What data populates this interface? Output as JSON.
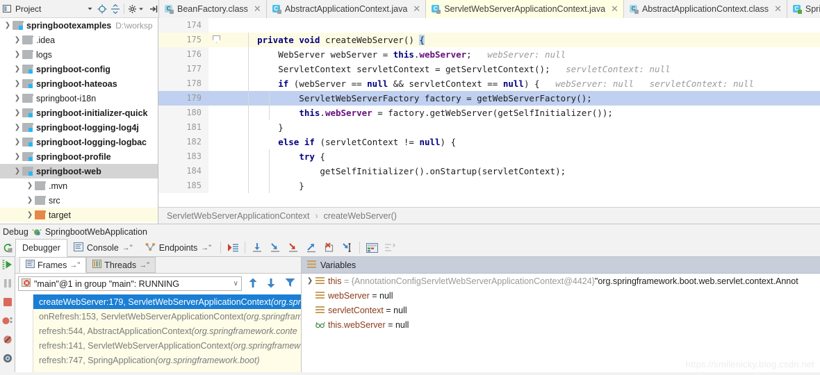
{
  "project_toolbar": {
    "label": "Project",
    "icons": [
      "project-panel-icon",
      "caret-down-icon",
      "locate-icon",
      "expand-collapse-icon",
      "gear-icon",
      "hide-icon"
    ]
  },
  "editor_tabs": [
    {
      "label": "BeanFactory.class",
      "icon": "class-file-icon",
      "active": false,
      "closable": true
    },
    {
      "label": "AbstractApplicationContext.java",
      "icon": "java-file-icon",
      "active": false,
      "closable": true
    },
    {
      "label": "ServletWebServerApplicationContext.java",
      "icon": "java-file-icon",
      "active": true,
      "closable": true
    },
    {
      "label": "AbstractApplicationContext.class",
      "icon": "class-file-icon",
      "active": false,
      "closable": true
    },
    {
      "label": "SpringA",
      "icon": "runnable-java-file-icon",
      "active": false,
      "closable": false
    }
  ],
  "project_tree": [
    {
      "label": "springbootexamples",
      "path": "D:\\worksp",
      "indent": 0,
      "bold": true,
      "expanded": true,
      "folder": "module",
      "selected": false
    },
    {
      "label": ".idea",
      "path": "",
      "indent": 1,
      "bold": false,
      "expanded": false,
      "folder": "plain",
      "selected": false
    },
    {
      "label": "logs",
      "path": "",
      "indent": 1,
      "bold": false,
      "expanded": false,
      "folder": "plain",
      "selected": false
    },
    {
      "label": "springboot-config",
      "path": "",
      "indent": 1,
      "bold": true,
      "expanded": false,
      "folder": "module",
      "selected": false
    },
    {
      "label": "springboot-hateoas",
      "path": "",
      "indent": 1,
      "bold": true,
      "expanded": false,
      "folder": "module",
      "selected": false
    },
    {
      "label": "springboot-i18n",
      "path": "",
      "indent": 1,
      "bold": false,
      "expanded": false,
      "folder": "plain",
      "selected": false
    },
    {
      "label": "springboot-initializer-quick",
      "path": "",
      "indent": 1,
      "bold": true,
      "expanded": false,
      "folder": "module",
      "selected": false
    },
    {
      "label": "springboot-logging-log4j",
      "path": "",
      "indent": 1,
      "bold": true,
      "expanded": false,
      "folder": "module",
      "selected": false
    },
    {
      "label": "springboot-logging-logbac",
      "path": "",
      "indent": 1,
      "bold": true,
      "expanded": false,
      "folder": "module",
      "selected": false
    },
    {
      "label": "springboot-profile",
      "path": "",
      "indent": 1,
      "bold": true,
      "expanded": false,
      "folder": "module",
      "selected": false
    },
    {
      "label": "springboot-web",
      "path": "",
      "indent": 1,
      "bold": true,
      "expanded": true,
      "folder": "module",
      "selected": true
    },
    {
      "label": ".mvn",
      "path": "",
      "indent": 2,
      "bold": false,
      "expanded": false,
      "folder": "plain",
      "selected": false
    },
    {
      "label": "src",
      "path": "",
      "indent": 2,
      "bold": false,
      "expanded": false,
      "folder": "plain",
      "selected": false
    },
    {
      "label": "target",
      "path": "",
      "indent": 2,
      "bold": false,
      "expanded": false,
      "folder": "orange",
      "selected": false,
      "highlighted": true
    }
  ],
  "code_lines": [
    {
      "num": "174",
      "highlight": "none",
      "fold": false,
      "tokens": []
    },
    {
      "num": "175",
      "highlight": "current",
      "fold": true,
      "tokens": [
        {
          "t": "    ",
          "c": "pln"
        },
        {
          "t": "private void ",
          "c": "kw"
        },
        {
          "t": "createWebServer() ",
          "c": "pln"
        },
        {
          "t": "{",
          "c": "caret"
        }
      ]
    },
    {
      "num": "176",
      "highlight": "none",
      "fold": false,
      "tokens": [
        {
          "t": "        WebServer webServer = ",
          "c": "pln"
        },
        {
          "t": "this",
          "c": "kw"
        },
        {
          "t": ".",
          "c": "pln"
        },
        {
          "t": "webServer",
          "c": "fld"
        },
        {
          "t": ";",
          "c": "pln"
        },
        {
          "t": "   webServer: null",
          "c": "hint"
        }
      ]
    },
    {
      "num": "177",
      "highlight": "none",
      "fold": false,
      "tokens": [
        {
          "t": "        ServletContext servletContext = getServletContext();",
          "c": "pln"
        },
        {
          "t": "   servletContext: null",
          "c": "hint"
        }
      ]
    },
    {
      "num": "178",
      "highlight": "none",
      "fold": false,
      "tokens": [
        {
          "t": "        ",
          "c": "pln"
        },
        {
          "t": "if ",
          "c": "kw"
        },
        {
          "t": "(webServer == ",
          "c": "pln"
        },
        {
          "t": "null",
          "c": "kw"
        },
        {
          "t": " && servletContext == ",
          "c": "pln"
        },
        {
          "t": "null",
          "c": "kw"
        },
        {
          "t": ") {",
          "c": "pln"
        },
        {
          "t": "   webServer: null   servletContext: null",
          "c": "hint"
        }
      ]
    },
    {
      "num": "179",
      "highlight": "exec",
      "fold": false,
      "tokens": [
        {
          "t": "            ServletWebServerFactory factory = getWebServerFactory();",
          "c": "pln"
        }
      ]
    },
    {
      "num": "180",
      "highlight": "none",
      "fold": false,
      "tokens": [
        {
          "t": "            ",
          "c": "pln"
        },
        {
          "t": "this",
          "c": "kw"
        },
        {
          "t": ".",
          "c": "pln"
        },
        {
          "t": "webServer",
          "c": "fld"
        },
        {
          "t": " = factory.getWebServer(getSelfInitializer());",
          "c": "pln"
        }
      ]
    },
    {
      "num": "181",
      "highlight": "none",
      "fold": false,
      "tokens": [
        {
          "t": "        }",
          "c": "pln"
        }
      ]
    },
    {
      "num": "182",
      "highlight": "none",
      "fold": false,
      "tokens": [
        {
          "t": "        ",
          "c": "pln"
        },
        {
          "t": "else if ",
          "c": "kw"
        },
        {
          "t": "(servletContext != ",
          "c": "pln"
        },
        {
          "t": "null",
          "c": "kw"
        },
        {
          "t": ") {",
          "c": "pln"
        }
      ]
    },
    {
      "num": "183",
      "highlight": "none",
      "fold": false,
      "tokens": [
        {
          "t": "            ",
          "c": "pln"
        },
        {
          "t": "try ",
          "c": "kw"
        },
        {
          "t": "{",
          "c": "pln"
        }
      ]
    },
    {
      "num": "184",
      "highlight": "none",
      "fold": false,
      "tokens": [
        {
          "t": "                getSelfInitializer().onStartup(servletContext);",
          "c": "pln"
        }
      ]
    },
    {
      "num": "185",
      "highlight": "none",
      "fold": false,
      "tokens": [
        {
          "t": "            }",
          "c": "pln"
        }
      ]
    }
  ],
  "breadcrumb": {
    "class": "ServletWebServerApplicationContext",
    "separator": "›",
    "method": "createWebServer()"
  },
  "debug_header": {
    "label": "Debug",
    "config_name": "SpringbootWebApplication",
    "icon": "debug-bug-icon"
  },
  "debug_tabs": [
    {
      "label": "Debugger",
      "icon": "",
      "pinned": false,
      "active": true
    },
    {
      "label": "Console",
      "icon": "console-icon",
      "pinned": true,
      "active": false
    },
    {
      "label": "Endpoints",
      "icon": "endpoints-icon",
      "pinned": true,
      "active": false
    }
  ],
  "debug_toolbar_buttons": [
    {
      "name": "show-execution-point-icon"
    },
    {
      "name": "step-over-icon"
    },
    {
      "name": "step-into-icon"
    },
    {
      "name": "force-step-into-icon"
    },
    {
      "name": "step-out-icon"
    },
    {
      "name": "drop-frame-icon"
    },
    {
      "name": "run-to-cursor-icon"
    },
    {
      "name": "evaluate-expression-icon"
    },
    {
      "name": "settings-layout-icon"
    }
  ],
  "left_rail_buttons": [
    {
      "name": "resume-program-icon"
    },
    {
      "name": "pause-program-icon"
    },
    {
      "name": "stop-icon"
    },
    {
      "name": "view-breakpoints-icon"
    },
    {
      "name": "mute-breakpoints-icon"
    },
    {
      "name": "debugger-settings-icon"
    }
  ],
  "frames_panel": {
    "tabs": [
      {
        "label": "Frames",
        "icon": "frames-icon",
        "pinned": true,
        "active": true
      },
      {
        "label": "Threads",
        "icon": "threads-icon",
        "pinned": true,
        "active": false
      }
    ],
    "thread_selector": {
      "value": "\"main\"@1 in group \"main\": RUNNING",
      "icon": "thread-running-icon",
      "caret": "∨"
    },
    "nav_buttons": [
      {
        "name": "move-up-icon"
      },
      {
        "name": "move-down-icon"
      },
      {
        "name": "filter-frames-icon"
      }
    ],
    "frames": [
      {
        "method": "createWebServer:179, ServletWebServerApplicationContext",
        "package": "(org.spr",
        "selected": true
      },
      {
        "method": "onRefresh:153, ServletWebServerApplicationContext",
        "package": "(org.springfram",
        "selected": false
      },
      {
        "method": "refresh:544, AbstractApplicationContext",
        "package": "(org.springframework.conte",
        "selected": false
      },
      {
        "method": "refresh:141, ServletWebServerApplicationContext",
        "package": "(org.springframew",
        "selected": false
      },
      {
        "method": "refresh:747, SpringApplication",
        "package": "(org.springframework.boot)",
        "selected": false
      }
    ]
  },
  "variables_panel": {
    "title": "Variables",
    "title_icon": "variables-icon",
    "rows": [
      {
        "expandable": true,
        "icon": "object-value-icon",
        "name": "this",
        "value": "= {AnnotationConfigServletWebServerApplicationContext@4424}",
        "value2": "\"org.springframework.boot.web.servlet.context.Annot"
      },
      {
        "expandable": false,
        "icon": "object-value-icon",
        "name": "webServer",
        "value": "= null",
        "value2": ""
      },
      {
        "expandable": false,
        "icon": "object-value-icon",
        "name": "servletContext",
        "value": "= null",
        "value2": ""
      },
      {
        "expandable": false,
        "icon": "watch-icon",
        "name": "this.webServer",
        "value": "= null",
        "value2": ""
      }
    ]
  },
  "watermark": "https://smilenicky.blog.csdn.net",
  "colors": {
    "tab_active_bg": "#ffffe4",
    "exec_line_bg": "#c0d0f0",
    "current_line_bg": "#fdfbe4",
    "frame_selected_bg": "#1a7fd4",
    "frames_bg": "#fffde8",
    "variables_header_bg": "#c9cedb",
    "keyword": "#000080",
    "field": "#660e7a",
    "hint": "#9a9a9a",
    "var_name": "#8a3a1a"
  }
}
